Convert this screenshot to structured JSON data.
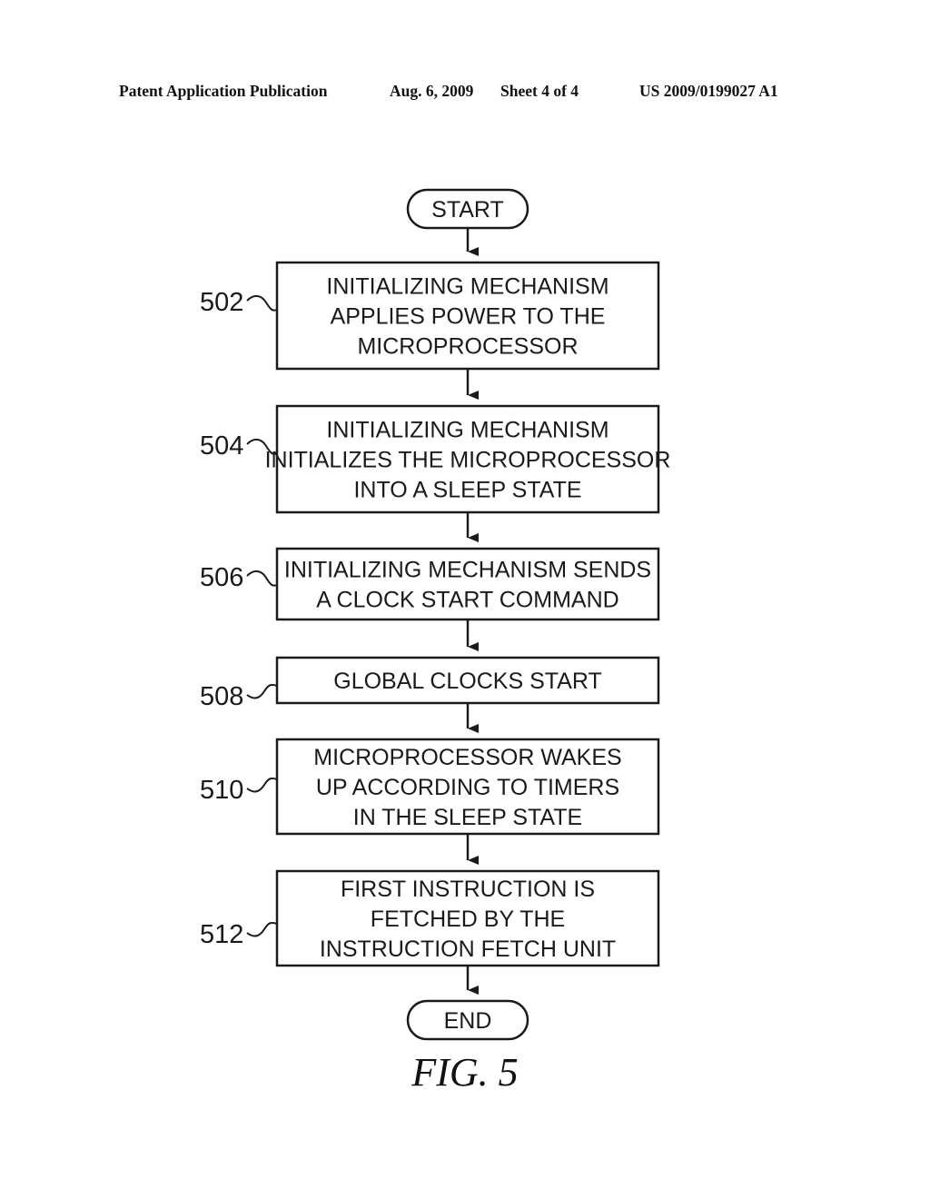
{
  "header": {
    "publication": "Patent Application Publication",
    "date": "Aug. 6, 2009",
    "sheet": "Sheet 4 of 4",
    "number": "US 2009/0199027 A1"
  },
  "flowchart": {
    "start_label": "START",
    "end_label": "END",
    "steps": [
      {
        "ref": "502",
        "lines": [
          "INITIALIZING MECHANISM",
          "APPLIES POWER TO THE",
          "MICROPROCESSOR"
        ]
      },
      {
        "ref": "504",
        "lines": [
          "INITIALIZING MECHANISM",
          "INITIALIZES THE MICROPROCESSOR",
          "INTO A SLEEP STATE"
        ]
      },
      {
        "ref": "506",
        "lines": [
          "INITIALIZING MECHANISM SENDS",
          "A CLOCK START COMMAND"
        ]
      },
      {
        "ref": "508",
        "lines": [
          "GLOBAL CLOCKS START"
        ]
      },
      {
        "ref": "510",
        "lines": [
          "MICROPROCESSOR WAKES",
          "UP ACCORDING TO TIMERS",
          "IN THE SLEEP STATE"
        ]
      },
      {
        "ref": "512",
        "lines": [
          "FIRST INSTRUCTION IS",
          "FETCHED BY THE",
          "INSTRUCTION FETCH UNIT"
        ]
      }
    ]
  },
  "figure_label": "FIG. 5"
}
